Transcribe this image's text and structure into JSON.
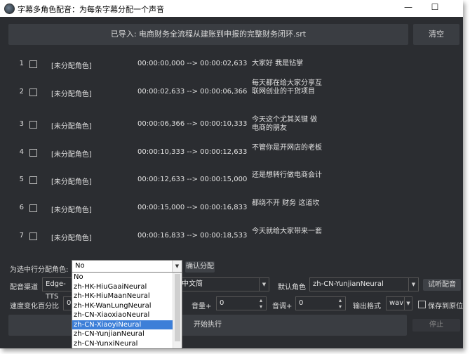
{
  "window": {
    "title": "字幕多角色配音：为每条字幕分配一个声音",
    "minimize": "—",
    "maximize": "☐"
  },
  "top": {
    "imported_label": "已导入: 电商财务全流程从建账到申报的完整财务闭环.srt",
    "clear_label": "清空"
  },
  "rows": [
    {
      "num": "1",
      "role": "[未分配角色]",
      "time": "00:00:00,000 --> 00:00:02,633",
      "text": "大家好 我是钻掌"
    },
    {
      "num": "2",
      "role": "[未分配角色]",
      "time": "00:00:02,633 --> 00:00:06,366",
      "text": "每天都在给大家分享互联网创业的干货项目"
    },
    {
      "num": "3",
      "role": "[未分配角色]",
      "time": "00:00:06,366 --> 00:00:10,333",
      "text": "今天这个尤其关键  做电商的朋友"
    },
    {
      "num": "4",
      "role": "[未分配角色]",
      "time": "00:00:10,333 --> 00:00:12,633",
      "text": "不管你是开网店的老板"
    },
    {
      "num": "5",
      "role": "[未分配角色]",
      "time": "00:00:12,633 --> 00:00:15,000",
      "text": "还是想转行做电商会计"
    },
    {
      "num": "6",
      "role": "[未分配角色]",
      "time": "00:00:15,000 --> 00:00:16,833",
      "text": "都绕不开  财务  这道坎"
    },
    {
      "num": "7",
      "role": "[未分配角色]",
      "time": "00:00:16,833 --> 00:00:18,533",
      "text": "今天就给大家带来一套"
    }
  ],
  "assign": {
    "label": "为选中行分配角色:",
    "value": "No",
    "confirm": "确认分配"
  },
  "channel": {
    "label": "配音渠道",
    "value": "Edge-TTS",
    "lang_value": "中文简",
    "default_role_label": "默认角色",
    "default_role_value": "zh-CN-YunjianNeural",
    "preview": "试听配音"
  },
  "speed": {
    "label": "速度变化百分比",
    "value": "0",
    "volume_label": "音量+",
    "volume_value": "0",
    "pitch_label": "音调+",
    "pitch_value": "0",
    "format_label": "输出格式",
    "format_value": "wav",
    "save_label": "保存到原位"
  },
  "actions": {
    "start": "开始执行",
    "stop": "停止"
  },
  "dropdown_options": [
    "No",
    "zh-HK-HiuGaaiNeural",
    "zh-HK-HiuMaanNeural",
    "zh-HK-WanLungNeural",
    "zh-CN-XiaoxiaoNeural",
    "zh-CN-XiaoyiNeural",
    "zh-CN-YunjianNeural",
    "zh-CN-YunxiNeural"
  ],
  "dropdown_selected": "zh-CN-XiaoyiNeural",
  "colors": {
    "background": "#2b2d31",
    "panel": "#3a3d42",
    "selection": "#3d7fd8"
  }
}
